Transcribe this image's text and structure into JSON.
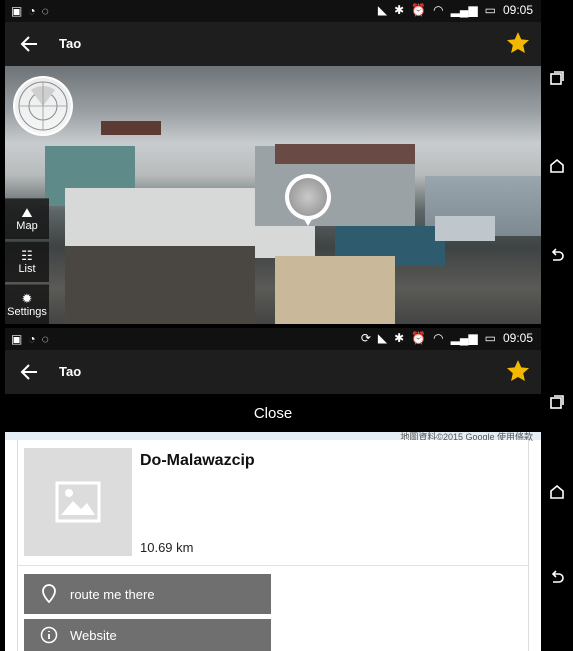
{
  "status_top": {
    "time": "09:05"
  },
  "status_bottom": {
    "time": "09:05"
  },
  "header_top": {
    "title": "Tao"
  },
  "header_bottom": {
    "title": "Tao"
  },
  "ar_view": {
    "marker_label": "Do-Malawazcip",
    "side_menu": [
      {
        "label": "Map",
        "icon": "map-icon"
      },
      {
        "label": "List",
        "icon": "list-icon"
      },
      {
        "label": "Settings",
        "icon": "settings-icon"
      }
    ]
  },
  "detail": {
    "close_label": "Close",
    "map_attribution": "地圖資料©2015 Google   使用條款",
    "poi_name": "Do-Malawazcip",
    "distance": "10.69 km",
    "actions": [
      {
        "label": "route me there",
        "icon": "location-pin-icon"
      },
      {
        "label": "Website",
        "icon": "info-icon"
      }
    ]
  },
  "colors": {
    "star": "#F5B800",
    "appbar": "#1e1e1e",
    "action_button": "#6f6f6f"
  }
}
